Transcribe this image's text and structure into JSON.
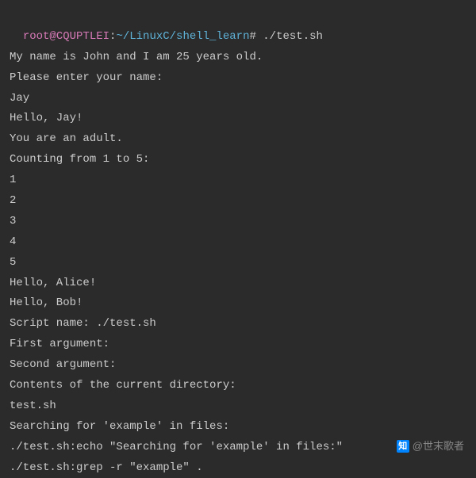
{
  "prompt": {
    "user": "root@CQUPTLEI",
    "separator": ":",
    "path": "~/LinuxC/shell_learn",
    "symbol": "#",
    "command": "./test.sh"
  },
  "output": [
    "My name is John and I am 25 years old.",
    "Please enter your name:",
    "Jay",
    "Hello, Jay!",
    "You are an adult.",
    "Counting from 1 to 5:",
    "1",
    "2",
    "3",
    "4",
    "5",
    "Hello, Alice!",
    "Hello, Bob!",
    "Script name: ./test.sh",
    "First argument:",
    "Second argument:",
    "Contents of the current directory:",
    "test.sh",
    "Searching for 'example' in files:",
    "./test.sh:echo \"Searching for 'example' in files:\"",
    "./test.sh:grep -r \"example\" ."
  ],
  "watermark": {
    "icon": "知",
    "text": "@世末歌者"
  }
}
